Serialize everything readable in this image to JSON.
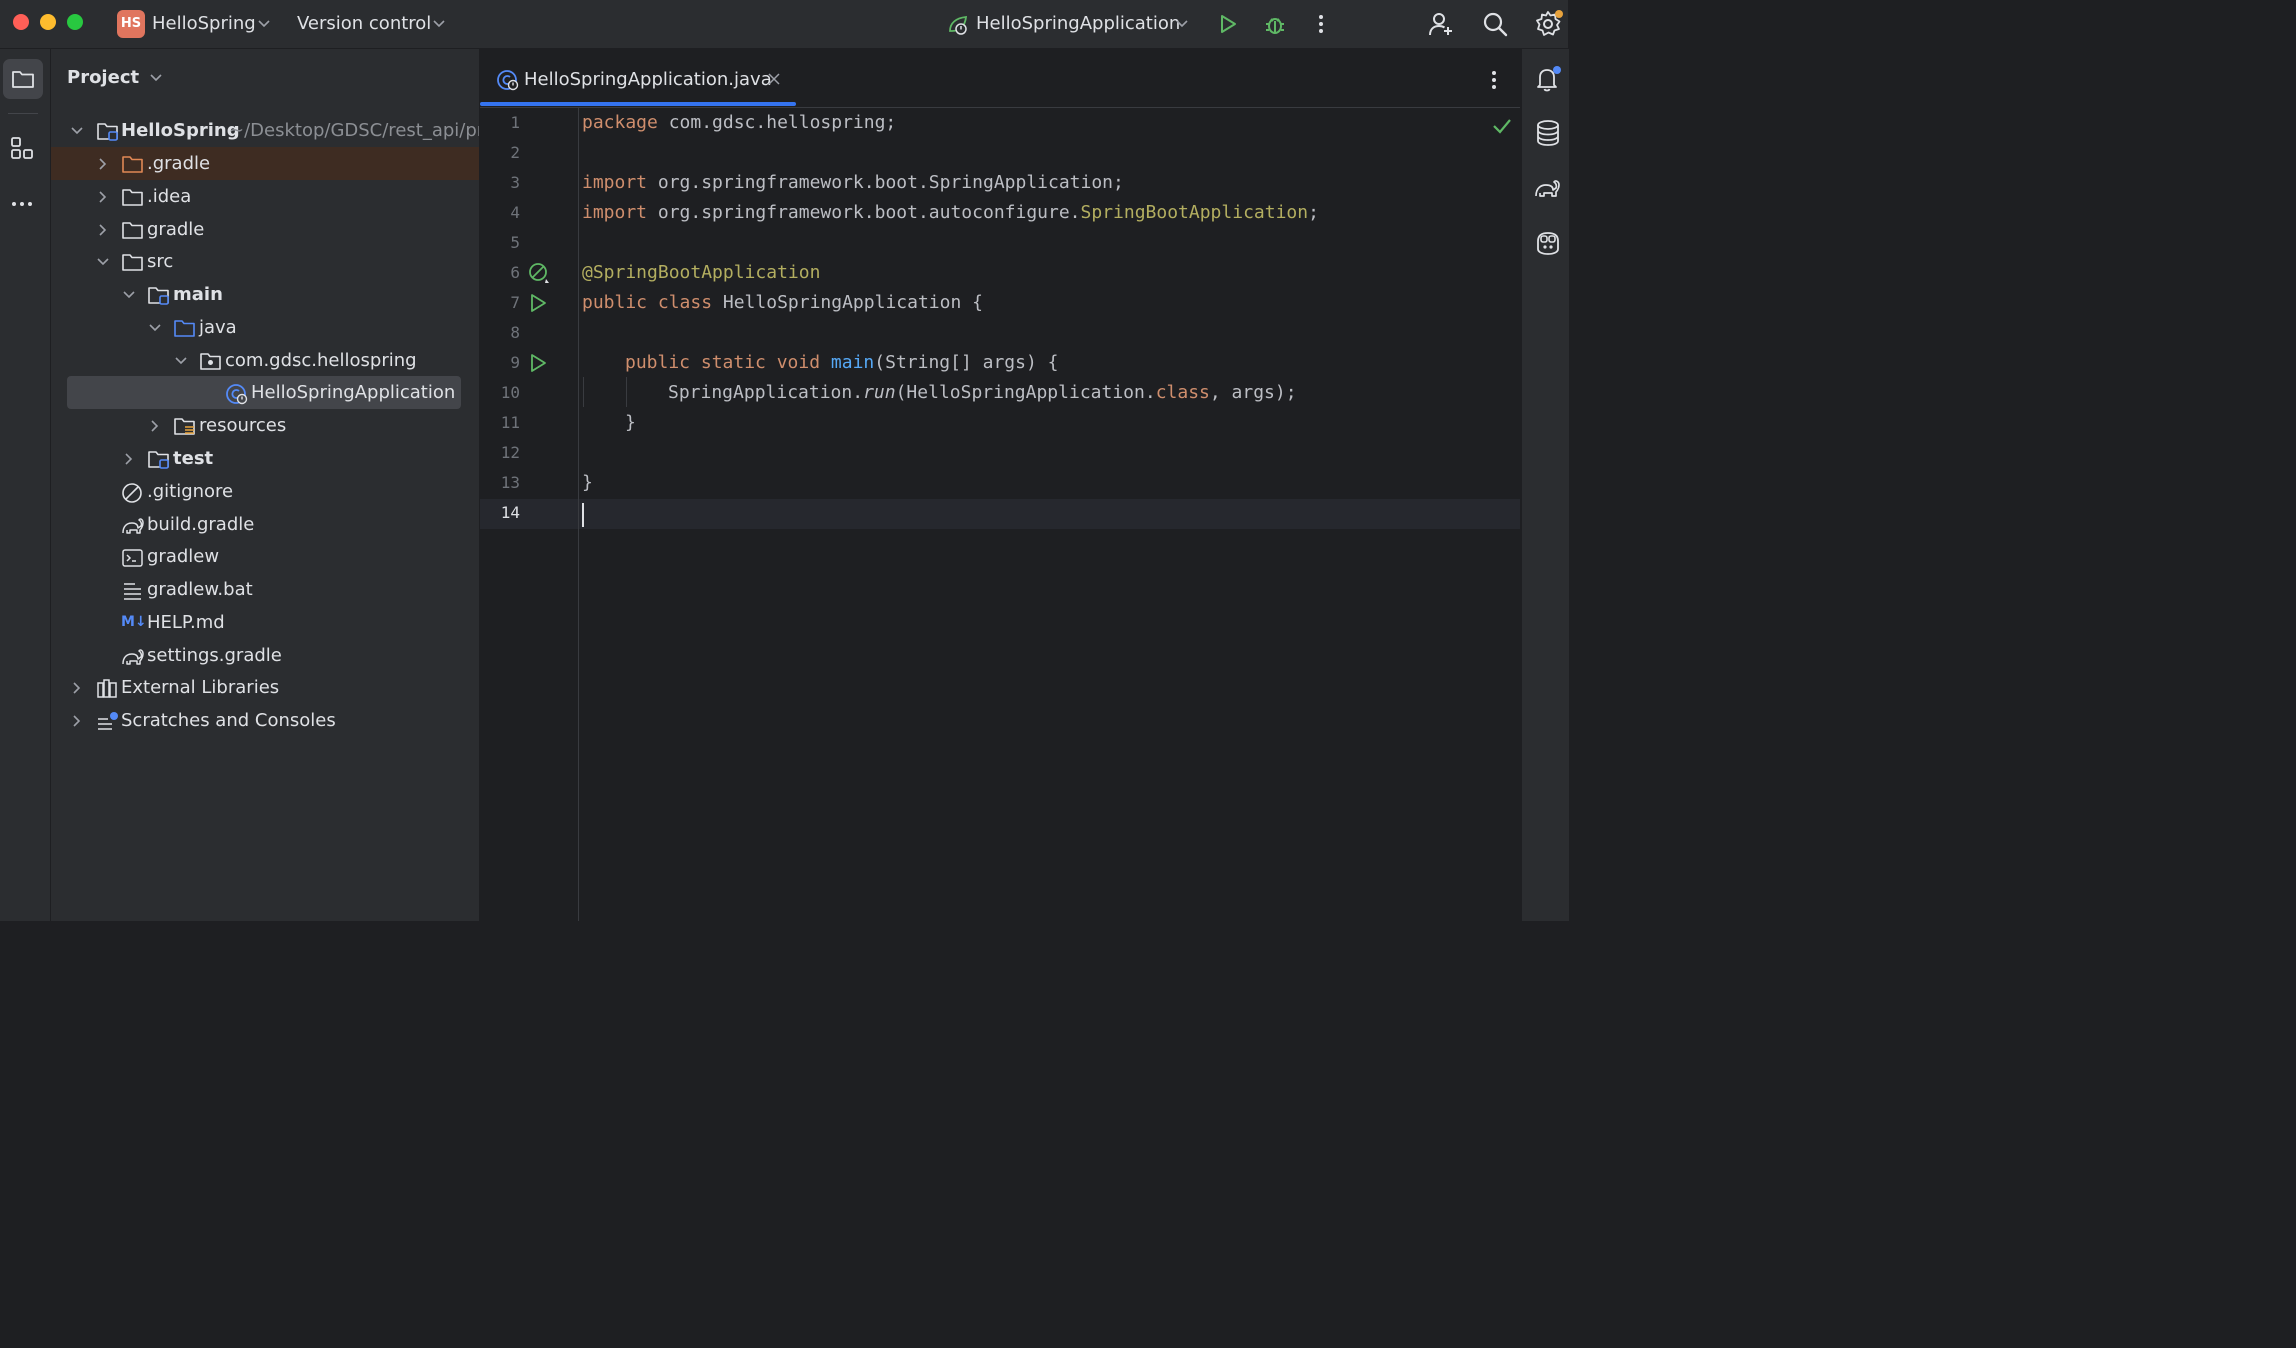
{
  "window": {
    "project_badge": "HS",
    "project_name": "HelloSpring",
    "vcs_label": "Version control",
    "run_config": "HelloSpringApplication"
  },
  "project_panel": {
    "title": "Project",
    "tree": [
      {
        "label": "HelloSpring",
        "path_hint": "~/Desktop/GDSC/rest_api/pro",
        "type": "module"
      },
      {
        "label": ".gradle",
        "type": "folder-excluded"
      },
      {
        "label": ".idea",
        "type": "folder"
      },
      {
        "label": "gradle",
        "type": "folder"
      },
      {
        "label": "src",
        "type": "folder"
      },
      {
        "label": "main",
        "type": "source-root"
      },
      {
        "label": "java",
        "type": "folder-source"
      },
      {
        "label": "com.gdsc.hellospring",
        "type": "package"
      },
      {
        "label": "HelloSpringApplication",
        "type": "spring-class"
      },
      {
        "label": "resources",
        "type": "folder-resources"
      },
      {
        "label": "test",
        "type": "source-root"
      },
      {
        "label": ".gitignore",
        "type": "ignore-file"
      },
      {
        "label": "build.gradle",
        "type": "gradle-file"
      },
      {
        "label": "gradlew",
        "type": "shell-file"
      },
      {
        "label": "gradlew.bat",
        "type": "text-file"
      },
      {
        "label": "HELP.md",
        "type": "markdown-file",
        "badge": "M↓"
      },
      {
        "label": "settings.gradle",
        "type": "gradle-file"
      },
      {
        "label": "External Libraries",
        "type": "libraries"
      },
      {
        "label": "Scratches and Consoles",
        "type": "scratches"
      }
    ]
  },
  "editor": {
    "tab_label": "HelloSpringApplication.java",
    "current_line": 14,
    "line_numbers": [
      "1",
      "2",
      "3",
      "4",
      "5",
      "6",
      "7",
      "8",
      "9",
      "10",
      "11",
      "12",
      "13",
      "14"
    ],
    "code": {
      "l1_kw": "package",
      "l1_rest": " com.gdsc.hellospring;",
      "l3_kw": "import",
      "l3_rest": " org.springframework.boot.SpringApplication;",
      "l4_kw": "import",
      "l4_rest": " org.springframework.boot.autoconfigure.",
      "l4_ann": "SpringBootApplication",
      "l4_end": ";",
      "l6_ann": "@SpringBootApplication",
      "l7_kw": "public class",
      "l7_rest": " HelloSpringApplication {",
      "l9_kw": "public static void",
      "l9_fn": " main",
      "l9_rest": "(String[] args) {",
      "l10_a": "SpringApplication.",
      "l10_it": "run",
      "l10_b": "(HelloSpringApplication.",
      "l10_kw": "class",
      "l10_c": ", args);",
      "l11": "}",
      "l13": "}"
    }
  },
  "colors": {
    "accent": "#3574f0",
    "keyword": "#cf8e6d",
    "annotation": "#b3ae60",
    "function": "#56a8f5",
    "run_green": "#5fb865"
  }
}
